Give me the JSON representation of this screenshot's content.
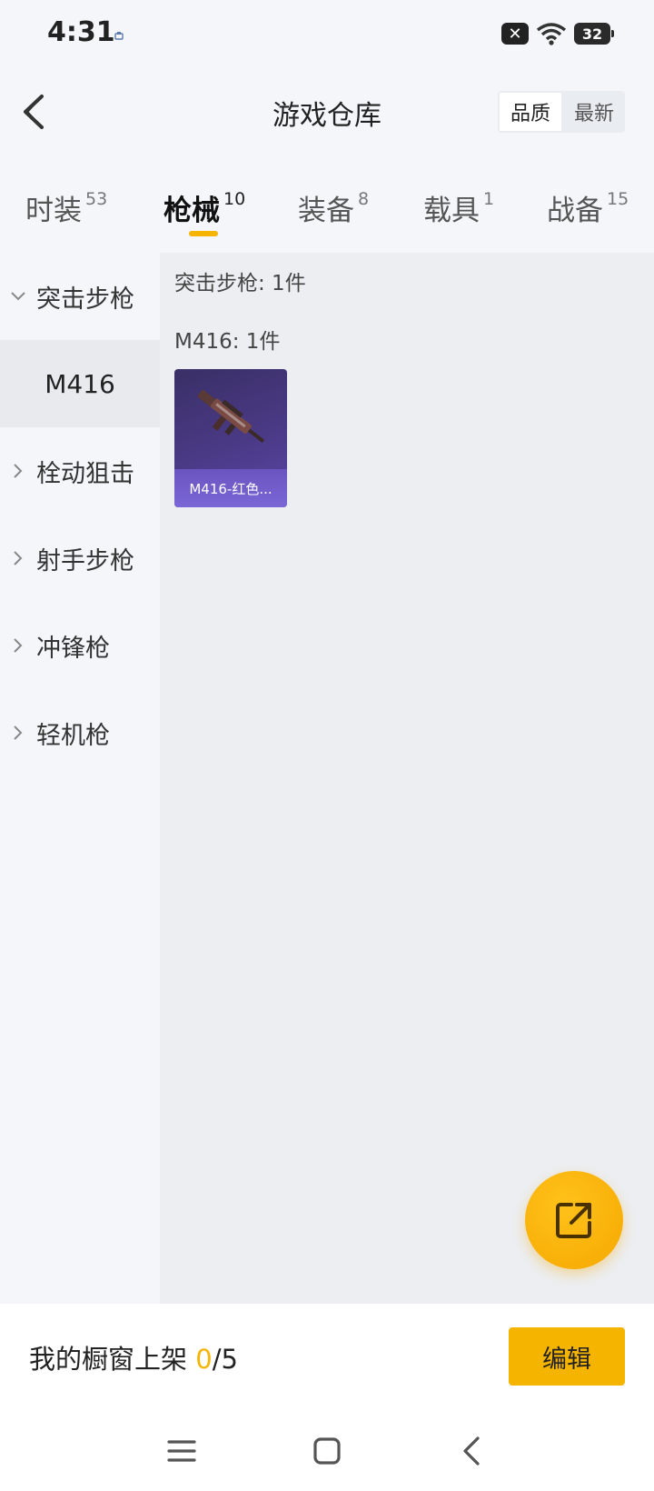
{
  "status": {
    "time": "4:31",
    "battery": "32"
  },
  "header": {
    "title": "游戏仓库",
    "sort_quality": "品质",
    "sort_newest": "最新"
  },
  "tabs": [
    {
      "label": "时装",
      "count": "53"
    },
    {
      "label": "枪械",
      "count": "10"
    },
    {
      "label": "装备",
      "count": "8"
    },
    {
      "label": "载具",
      "count": "1"
    },
    {
      "label": "战备",
      "count": "15"
    }
  ],
  "sidebar": {
    "items": [
      {
        "label": "突击步枪"
      },
      {
        "label": "M416"
      },
      {
        "label": "栓动狙击"
      },
      {
        "label": "射手步枪"
      },
      {
        "label": "冲锋枪"
      },
      {
        "label": "轻机枪"
      }
    ]
  },
  "main": {
    "category_count": "突击步枪: 1件",
    "model_count": "M416: 1件",
    "item_card": {
      "name": "M416-红色..."
    }
  },
  "bottom": {
    "shelf_label": "我的橱窗上架",
    "shelf_current": "0",
    "shelf_total": "/5",
    "edit_label": "编辑"
  },
  "colors": {
    "accent": "#f5b400",
    "card_bg": "#4a3a86"
  }
}
